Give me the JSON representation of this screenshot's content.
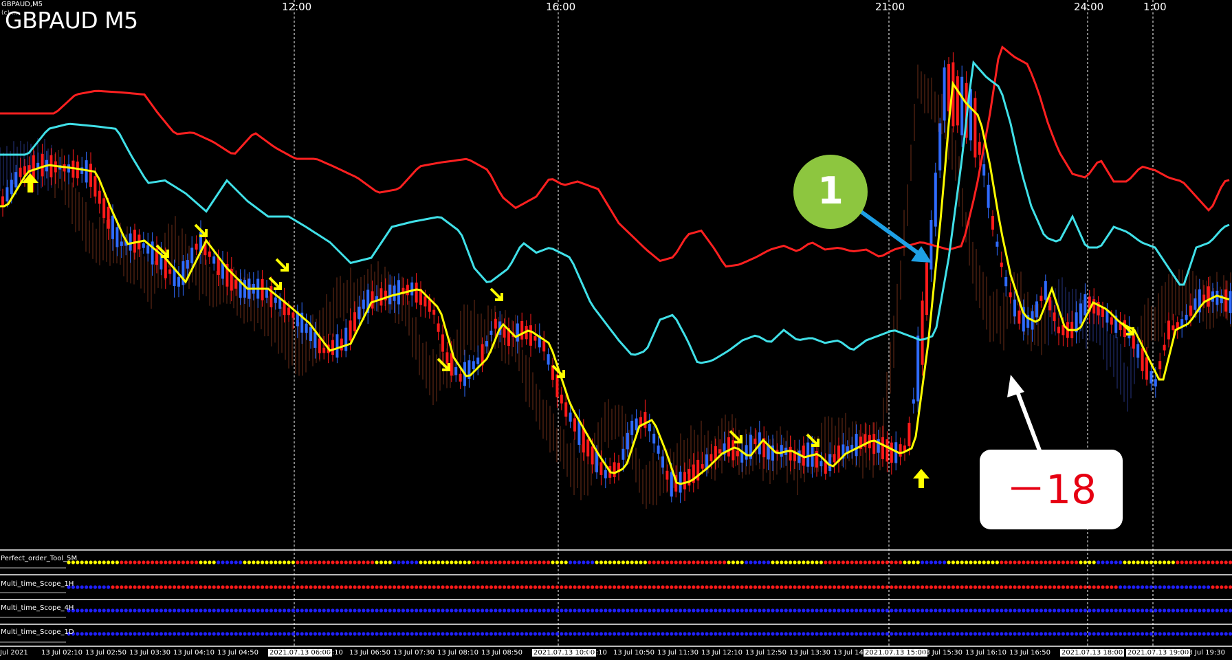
{
  "chart": {
    "symbol_header": "GBPAUD,M5",
    "title": "GBPAUD M5",
    "top_time_labels": [
      "12:00",
      "16:00",
      "21:00",
      "24:00",
      "1:00"
    ],
    "annotations": {
      "badge_number": "1",
      "callout_text": "－18"
    },
    "subwindows": [
      {
        "label": "Perfect_order_Tool_5M"
      },
      {
        "label": "Multi_time_Scope_1H"
      },
      {
        "label": "Multi_time_Scope_4H"
      },
      {
        "label": "Multi_time_Scope_1D"
      }
    ],
    "bottom_time_labels": [
      "Jul 2021",
      "13 Jul 02:10",
      "13 Jul 02:50",
      "13 Jul 03:30",
      "13 Jul 04:10",
      "13 Jul 04:50",
      "2021.07.13 06:00",
      "06:10",
      "13 Jul 06:50",
      "13 Jul 07:30",
      "13 Jul 08:10",
      "13 Jul 08:50",
      "2021.07.13 10:00",
      "10:10",
      "13 Jul 10:50",
      "13 Jul 11:30",
      "13 Jul 12:10",
      "13 Jul 12:50",
      "13 Jul 13:30",
      "13 Jul 14",
      "2021.07.13 15:00",
      "13 Jul 15:30",
      "13 Jul 16:10",
      "13 Jul 16:50",
      "2021.07.13 18:00",
      "2021.07.13 19:00",
      "13 Jul 19:30"
    ]
  },
  "colors": {
    "background": "#000000",
    "bull_candle": "#2f6bff",
    "bear_candle": "#ff1a1a",
    "ma_fast": "#ffff00",
    "ma_mid": "#40e0e8",
    "ma_slow": "#ff2020",
    "cloud_line": "#e8a070",
    "badge": "#8dc63f",
    "callout_text": "#e60012",
    "arrow_blue": "#1ea0e6"
  }
}
